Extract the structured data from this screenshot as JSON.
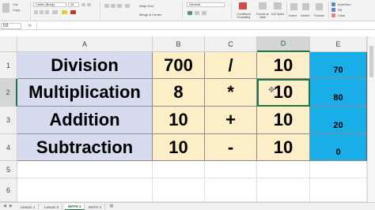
{
  "ribbon": {
    "cut": "Cut",
    "copy": "Copy",
    "font_name": "Calibri (Body)",
    "font_size": "26",
    "wrap_text": "Wrap Text",
    "merge_center": "Merge & Center",
    "number_format": "General",
    "conditional_formatting": "Conditional Formatting",
    "format_as_table": "Format as Table",
    "cell_styles": "Cell Styles",
    "insert": "Insert",
    "delete": "Delete",
    "format": "Format",
    "autosum": "AutoSum",
    "fill": "Fill",
    "clear": "Clear"
  },
  "formula_bar": {
    "name_box": "D2",
    "fx": "fx"
  },
  "columns": [
    "A",
    "B",
    "C",
    "D",
    "E"
  ],
  "rows": [
    "1",
    "2",
    "3",
    "4",
    "5",
    "6"
  ],
  "table": [
    {
      "a": "Division",
      "b": "700",
      "c": "/",
      "d": "10",
      "e": "70"
    },
    {
      "a": "Multiplication",
      "b": "8",
      "c": "*",
      "d": "10",
      "e": "80"
    },
    {
      "a": "Addition",
      "b": "10",
      "c": "+",
      "d": "10",
      "e": "20"
    },
    {
      "a": "Subtraction",
      "b": "10",
      "c": "-",
      "d": "10",
      "e": "0"
    }
  ],
  "sheet_tabs": [
    "Lesson 1",
    "Lesson 2",
    "MATH 1",
    "MATH 2"
  ],
  "active_sheet": "MATH 1",
  "active_cell": "D2",
  "colors": {
    "col_a_fill": "#d6dbf0",
    "col_bcd_fill": "#fcefc8",
    "col_e_fill": "#1aaee8",
    "excel_green": "#217346"
  }
}
